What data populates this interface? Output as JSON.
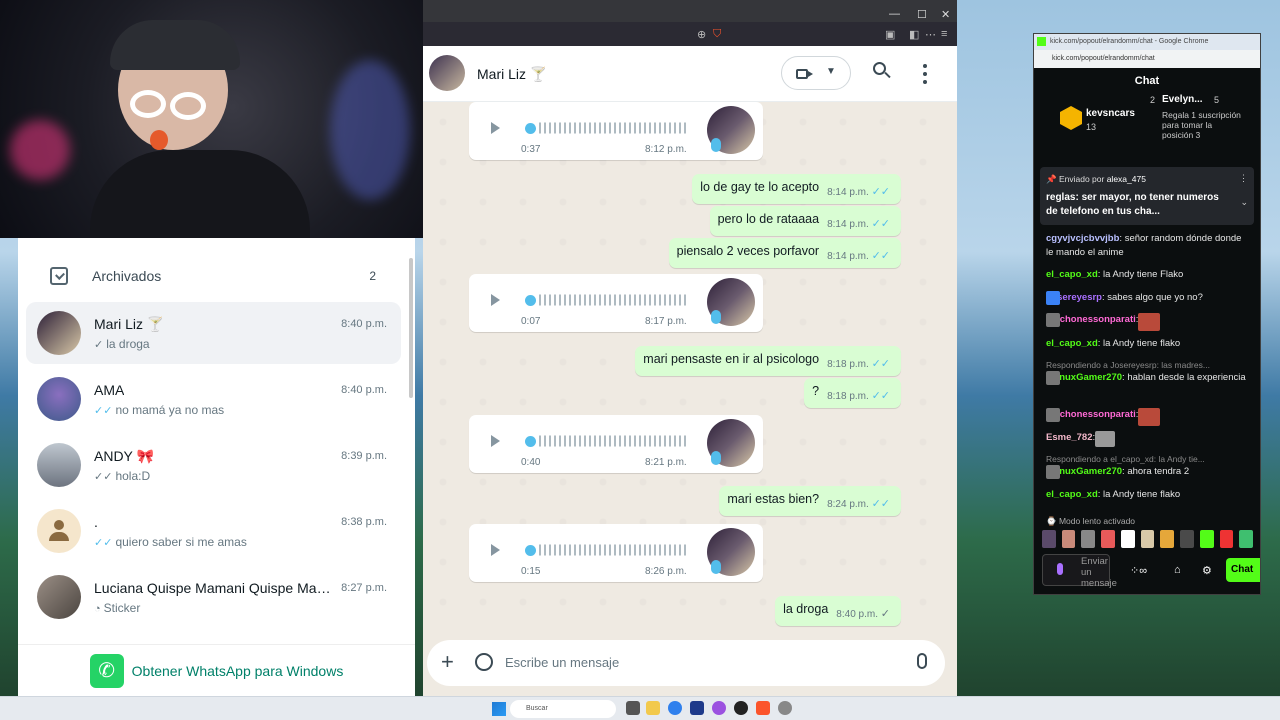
{
  "whatsapp_list": {
    "archived_label": "Archivados",
    "archived_count": "2",
    "chats": [
      {
        "name": "Mari Liz 🍸",
        "time": "8:40 p.m.",
        "last": "la droga",
        "tick": "grey"
      },
      {
        "name": "AMA",
        "time": "8:40 p.m.",
        "last": "no mamá ya no mas",
        "tick": "blue"
      },
      {
        "name": "ANDY 🎀",
        "time": "8:39 p.m.",
        "last": "hola:D",
        "tick": "grey"
      },
      {
        "name": ".",
        "time": "8:38 p.m.",
        "last": "quiero saber si me amas",
        "tick": "blue"
      },
      {
        "name": "Luciana Quispe Mamani Quispe Mam...",
        "time": "8:27 p.m.",
        "last": "Sticker",
        "tick": "none"
      }
    ],
    "get_app_label": "Obtener WhatsApp para Windows"
  },
  "conversation": {
    "contact_name": "Mari Liz 🍸",
    "voice_notes": [
      {
        "duration": "0:37",
        "time": "8:12 p.m."
      },
      {
        "duration": "0:07",
        "time": "8:17 p.m."
      },
      {
        "duration": "0:40",
        "time": "8:21 p.m."
      },
      {
        "duration": "0:15",
        "time": "8:26 p.m."
      }
    ],
    "messages": [
      {
        "text": "lo de gay te lo acepto",
        "time": "8:14 p.m."
      },
      {
        "text": "pero lo de rataaaa",
        "time": "8:14 p.m."
      },
      {
        "text": "piensalo 2 veces porfavor",
        "time": "8:14 p.m."
      },
      {
        "text": "mari pensaste en ir al psicologo",
        "time": "8:18 p.m."
      },
      {
        "text": "?",
        "time": "8:18 p.m."
      },
      {
        "text": "mari estas bien?",
        "time": "8:24 p.m."
      },
      {
        "text": "la droga",
        "time": "8:40 p.m."
      }
    ],
    "composer_placeholder": "Escribe un mensaje"
  },
  "kick_chat": {
    "window_title": "kick.com/popout/elrandomm/chat - Google Chrome",
    "url": "kick.com/popout/elrandomm/chat",
    "header": "Chat",
    "top_user": {
      "name": "kevsncars",
      "count": "13"
    },
    "top_user2": {
      "rank": "2",
      "name": "Evelyn...",
      "count": "5"
    },
    "subs_note": "Regala 1 suscripción para tomar la posición 3",
    "pinned_by": "Enviado por",
    "pinned_user": "alexa_475",
    "pinned_text": "reglas: ser mayor, no tener numeros de telefono en tus cha...",
    "messages": [
      {
        "user": "cgyvjvcjcbvvjbb",
        "text": "señor random dónde donde le mando el anime",
        "color": "#b9c0ff"
      },
      {
        "user": "el_capo_xd",
        "text": "la Andy tiene Flako",
        "color": "#53fc18"
      },
      {
        "user": "Josereyesrp",
        "text": "sabes algo que yo no?",
        "color": "#a970ff"
      },
      {
        "user": "chichonessonparati",
        "text": "",
        "color": "#ff6ad5"
      },
      {
        "user": "el_capo_xd",
        "text": "la Andy tiene flako",
        "color": "#53fc18"
      },
      {
        "reply": "Respondiendo a Josereyesrp: las madres..."
      },
      {
        "user": "ManuxGamer270",
        "text": "hablan desde la experiencia",
        "color": "#53fc18"
      },
      {
        "user": "chichonessonparati",
        "text": "",
        "color": "#ff6ad5"
      },
      {
        "user": "Esme_782",
        "text": "",
        "color": "#f2b7c9"
      },
      {
        "reply": "Respondiendo a el_capo_xd: la Andy tie..."
      },
      {
        "user": "ManuxGamer270",
        "text": "ahora tendra 2",
        "color": "#53fc18"
      },
      {
        "user": "el_capo_xd",
        "text": "la Andy tiene flako",
        "color": "#53fc18"
      }
    ],
    "slow_mode": "Modo lento activado",
    "input_placeholder": "Enviar un mensaje",
    "send_label": "Chat"
  },
  "taskbar": {
    "search_placeholder": "Buscar"
  }
}
